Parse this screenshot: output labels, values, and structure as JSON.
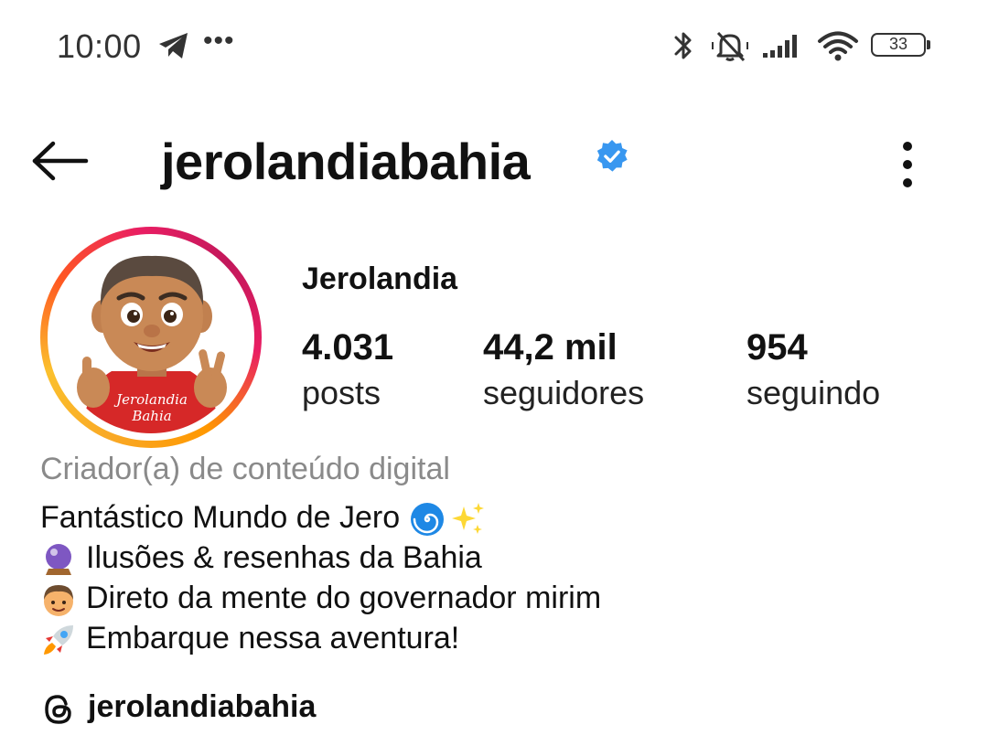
{
  "status_bar": {
    "time": "10:00",
    "battery_level": "33",
    "icons": [
      "telegram-icon",
      "more-notifications-icon",
      "bluetooth-icon",
      "muted-bell-icon",
      "signal-icon",
      "wifi-icon",
      "battery-icon"
    ]
  },
  "header": {
    "username": "jerolandiabahia",
    "verified": true,
    "accent_color": "#3897f0"
  },
  "profile": {
    "display_name": "Jerolandia",
    "avatar_text_line1": "Jerolandia",
    "avatar_text_line2": "Bahia",
    "stats": [
      {
        "value": "4.031",
        "label": "posts"
      },
      {
        "value": "44,2 mil",
        "label": "seguidores"
      },
      {
        "value": "954",
        "label": "seguindo"
      }
    ],
    "category": "Criador(a) de conteúdo digital",
    "bio": [
      {
        "text": "Fantástico Mundo de Jero",
        "emoji": "spiral-sparkles"
      },
      {
        "text": "Ilusões & resenhas da Bahia",
        "emoji": "crystal-ball"
      },
      {
        "text": "Direto da mente do governador mirim",
        "emoji": "boy"
      },
      {
        "text": "Embarque nessa aventura!",
        "emoji": "rocket"
      }
    ],
    "threads_handle": "jerolandiabahia"
  }
}
